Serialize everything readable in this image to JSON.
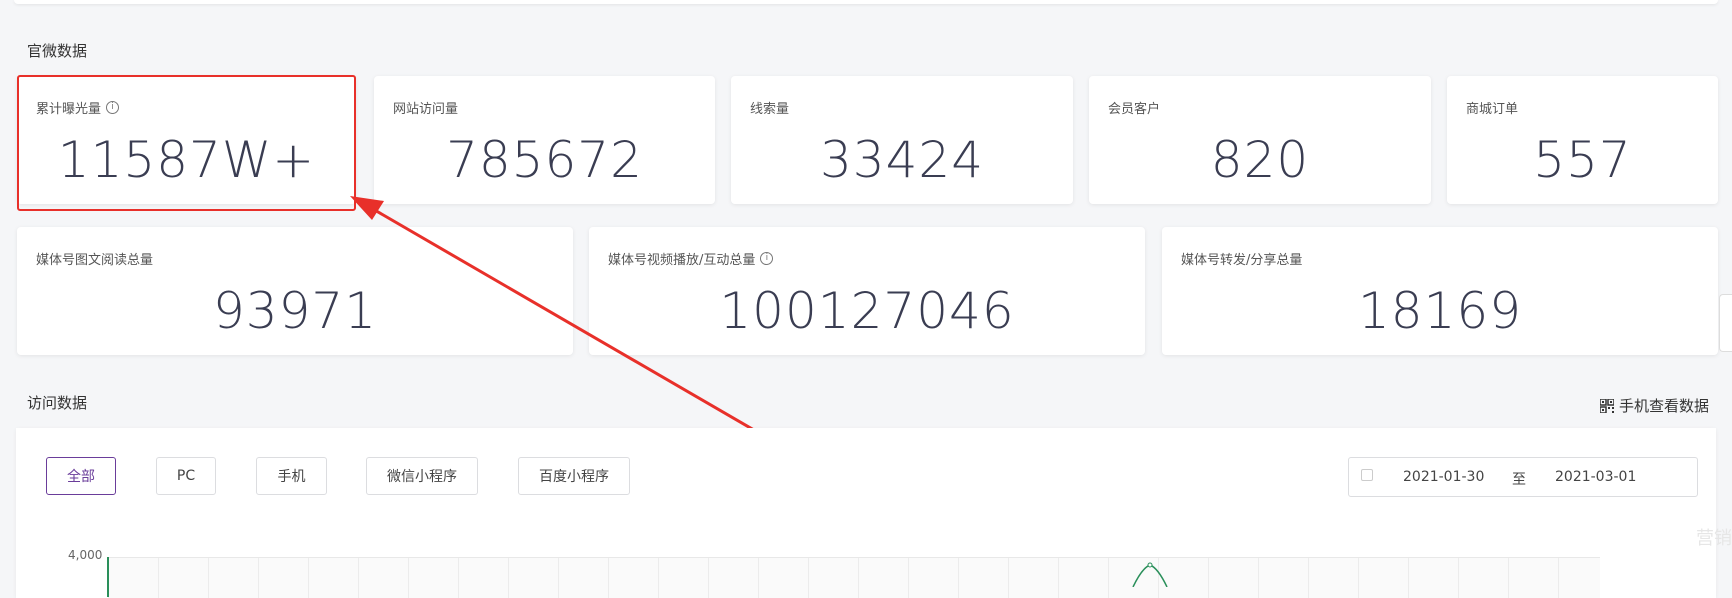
{
  "sections": {
    "official": "官微数据",
    "visits": "访问数据"
  },
  "stats_row1": [
    {
      "label": "累计曝光量",
      "value": "11587W+",
      "info": true
    },
    {
      "label": "网站访问量",
      "value": "785672"
    },
    {
      "label": "线索量",
      "value": "33424"
    },
    {
      "label": "会员客户",
      "value": "820"
    },
    {
      "label": "商城订单",
      "value": "557"
    }
  ],
  "stats_row2": [
    {
      "label": "媒体号图文阅读总量",
      "value": "93971"
    },
    {
      "label": "媒体号视频播放/互动总量",
      "value": "100127046",
      "info": true
    },
    {
      "label": "媒体号转发/分享总量",
      "value": "18169"
    }
  ],
  "info_glyph": "i",
  "mobile_view": "手机查看数据",
  "filters": [
    "全部",
    "PC",
    "手机",
    "微信小程序",
    "百度小程序"
  ],
  "active_filter": "全部",
  "date_range": {
    "start": "2021-01-30",
    "separator": "至",
    "end": "2021-03-01"
  },
  "chart_data": {
    "type": "line",
    "y_ticks": [
      "4,000"
    ],
    "grid": true
  },
  "watermark": "营销",
  "colors": {
    "accent": "#6a3d9a",
    "highlight": "#e8302a",
    "value_text": "#3a3d52",
    "chart_line": "#2a8f5a"
  }
}
